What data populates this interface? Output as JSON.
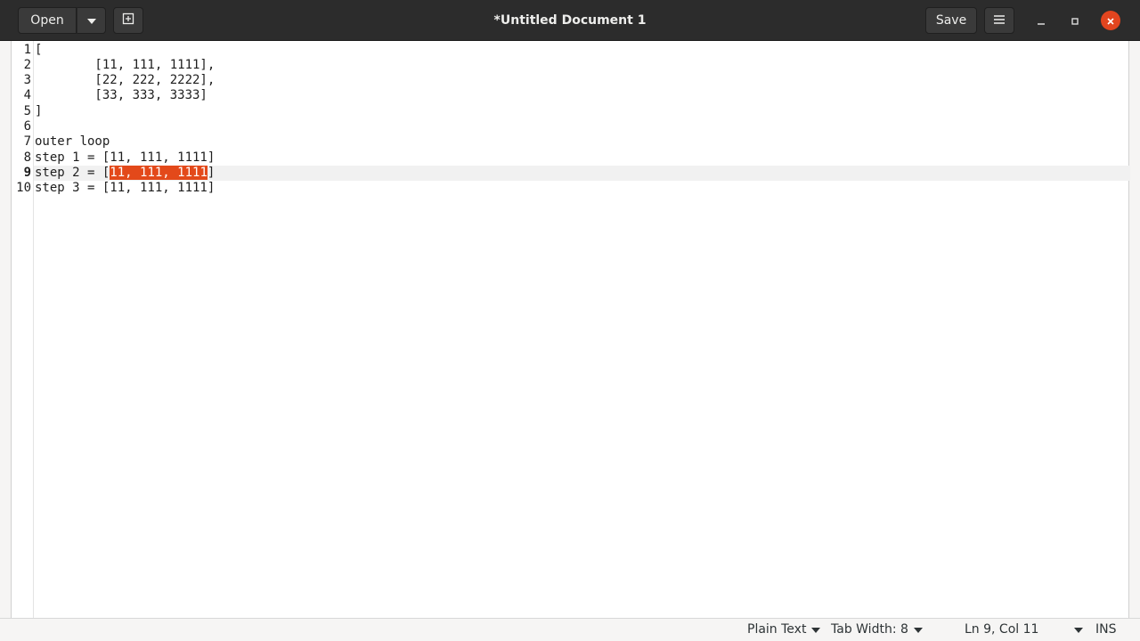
{
  "header": {
    "title": "*Untitled Document 1",
    "open_label": "Open",
    "save_label": "Save"
  },
  "editor": {
    "line_numbers": [
      "1",
      "2",
      "3",
      "4",
      "5",
      "6",
      "7",
      "8",
      "9",
      "10"
    ],
    "lines": [
      "[",
      "        [11, 111, 1111],",
      "        [22, 222, 2222],",
      "        [33, 333, 3333]",
      "]",
      "",
      "outer loop",
      "step 1 = [11, 111, 1111]",
      "step 2 = [",
      "step 3 = [11, 111, 1111]"
    ],
    "line9_selected": "11, 111, 1111",
    "line9_after": "]",
    "current_line": 9
  },
  "statusbar": {
    "language": "Plain Text",
    "tab_width": "Tab Width: 8",
    "position": "Ln 9, Col 11",
    "mode": "INS"
  },
  "colors": {
    "selection": "#e3491a",
    "close_button": "#e2451f",
    "headerbar": "#2c2c2c"
  }
}
